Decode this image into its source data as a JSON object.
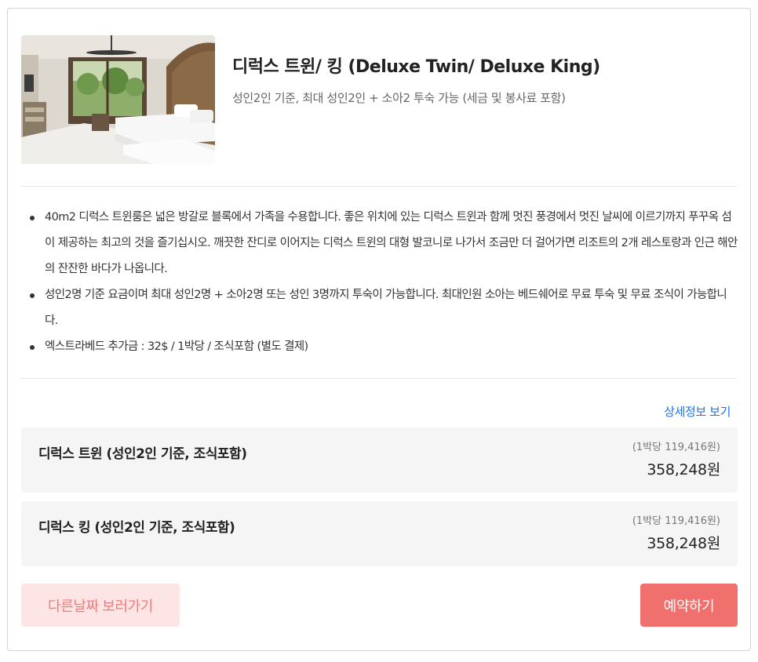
{
  "room": {
    "title": "디럭스 트윈/ 킹 (Deluxe Twin/ Deluxe King)",
    "subtitle": "성인2인 기준, 최대 성인2인 + 소아2 투숙 가능 (세금 및 봉사료 포함)",
    "photo_icon": "hotel-room-photo"
  },
  "description": [
    "40m2 디럭스 트윈룸은 넓은 방갈로 블록에서 가족을 수용합니다. 좋은 위치에 있는 디럭스 트윈과 함께 멋진 풍경에서 멋진 날씨에 이르기까지 푸꾸옥 섬이 제공하는 최고의 것을 즐기십시오. 깨끗한 잔디로 이어지는 디럭스 트윈의 대형 발코니로 나가서 조금만 더 걸어가면 리조트의 2개 레스토랑과 인근 해안의 잔잔한 바다가 나옵니다.",
    "성인2명 기준 요금이며 최대 성인2명 + 소아2명 또는 성인 3명까지 투숙이 가능합니다. 최대인원 소아는 베드쉐어로 무료 투숙 및 무료 조식이 가능합니다.",
    "엑스트라베드 추가금 : 32$ / 1박당 / 조식포함 (별도 결제)"
  ],
  "detail_link": "상세정보 보기",
  "options": [
    {
      "name": "디럭스 트윈 (성인2인 기준, 조식포함)",
      "per_night": "(1박당 119,416원)",
      "price": "358,248원"
    },
    {
      "name": "디럭스 킹 (성인2인 기준, 조식포함)",
      "per_night": "(1박당 119,416원)",
      "price": "358,248원"
    }
  ],
  "buttons": {
    "other_dates": "다른날짜 보러가기",
    "book": "예약하기"
  },
  "colors": {
    "link": "#1a73e8",
    "book_button": "#ef706d",
    "other_button_bg": "#fde5e5",
    "other_button_text": "#ef7b7b",
    "option_bg": "#f5f5f5"
  }
}
